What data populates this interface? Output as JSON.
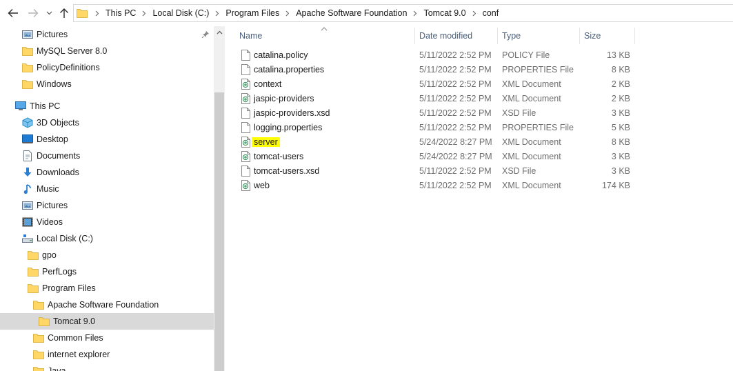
{
  "address": {
    "breadcrumbs": [
      "This PC",
      "Local Disk (C:)",
      "Program Files",
      "Apache Software Foundation",
      "Tomcat 9.0",
      "conf"
    ]
  },
  "nav": {
    "items": [
      {
        "label": "Pictures",
        "icon": "pictures-icon"
      },
      {
        "label": "MySQL Server 8.0",
        "icon": "folder-icon"
      },
      {
        "label": "PolicyDefinitions",
        "icon": "folder-icon"
      },
      {
        "label": "Windows",
        "icon": "folder-icon"
      },
      {
        "label": "This PC",
        "icon": "this-pc-icon"
      },
      {
        "label": "3D Objects",
        "icon": "3d-objects-icon"
      },
      {
        "label": "Desktop",
        "icon": "desktop-icon"
      },
      {
        "label": "Documents",
        "icon": "documents-icon"
      },
      {
        "label": "Downloads",
        "icon": "downloads-icon"
      },
      {
        "label": "Music",
        "icon": "music-icon"
      },
      {
        "label": "Pictures",
        "icon": "pictures-icon"
      },
      {
        "label": "Videos",
        "icon": "videos-icon"
      },
      {
        "label": "Local Disk (C:)",
        "icon": "drive-icon"
      },
      {
        "label": "gpo",
        "icon": "folder-icon"
      },
      {
        "label": "PerfLogs",
        "icon": "folder-icon"
      },
      {
        "label": "Program Files",
        "icon": "folder-icon"
      },
      {
        "label": "Apache Software Foundation",
        "icon": "folder-icon"
      },
      {
        "label": "Tomcat 9.0",
        "icon": "folder-icon",
        "selected": true
      },
      {
        "label": "Common Files",
        "icon": "folder-icon"
      },
      {
        "label": "internet explorer",
        "icon": "folder-icon"
      },
      {
        "label": "Java",
        "icon": "folder-icon"
      }
    ]
  },
  "columns": {
    "name": "Name",
    "date": "Date modified",
    "type": "Type",
    "size": "Size"
  },
  "files": [
    {
      "name": "catalina.policy",
      "date": "5/11/2022 2:52 PM",
      "type": "POLICY File",
      "size": "13 KB",
      "icon": "file-icon"
    },
    {
      "name": "catalina.properties",
      "date": "5/11/2022 2:52 PM",
      "type": "PROPERTIES File",
      "size": "8 KB",
      "icon": "file-icon"
    },
    {
      "name": "context",
      "date": "5/11/2022 2:52 PM",
      "type": "XML Document",
      "size": "2 KB",
      "icon": "xml-file-icon"
    },
    {
      "name": "jaspic-providers",
      "date": "5/11/2022 2:52 PM",
      "type": "XML Document",
      "size": "2 KB",
      "icon": "xml-file-icon"
    },
    {
      "name": "jaspic-providers.xsd",
      "date": "5/11/2022 2:52 PM",
      "type": "XSD File",
      "size": "3 KB",
      "icon": "file-icon"
    },
    {
      "name": "logging.properties",
      "date": "5/11/2022 2:52 PM",
      "type": "PROPERTIES File",
      "size": "5 KB",
      "icon": "file-icon"
    },
    {
      "name": "server",
      "date": "5/24/2022 8:27 PM",
      "type": "XML Document",
      "size": "8 KB",
      "icon": "xml-file-icon",
      "highlighted": true
    },
    {
      "name": "tomcat-users",
      "date": "5/24/2022 8:27 PM",
      "type": "XML Document",
      "size": "3 KB",
      "icon": "xml-file-icon"
    },
    {
      "name": "tomcat-users.xsd",
      "date": "5/11/2022 2:52 PM",
      "type": "XSD File",
      "size": "3 KB",
      "icon": "file-icon"
    },
    {
      "name": "web",
      "date": "5/11/2022 2:52 PM",
      "type": "XML Document",
      "size": "174 KB",
      "icon": "xml-file-icon"
    }
  ],
  "colors": {
    "folder": "#ffd766",
    "highlight": "#ffff00",
    "selected_row": "#d9d9d9",
    "header_text": "#4c607a"
  }
}
